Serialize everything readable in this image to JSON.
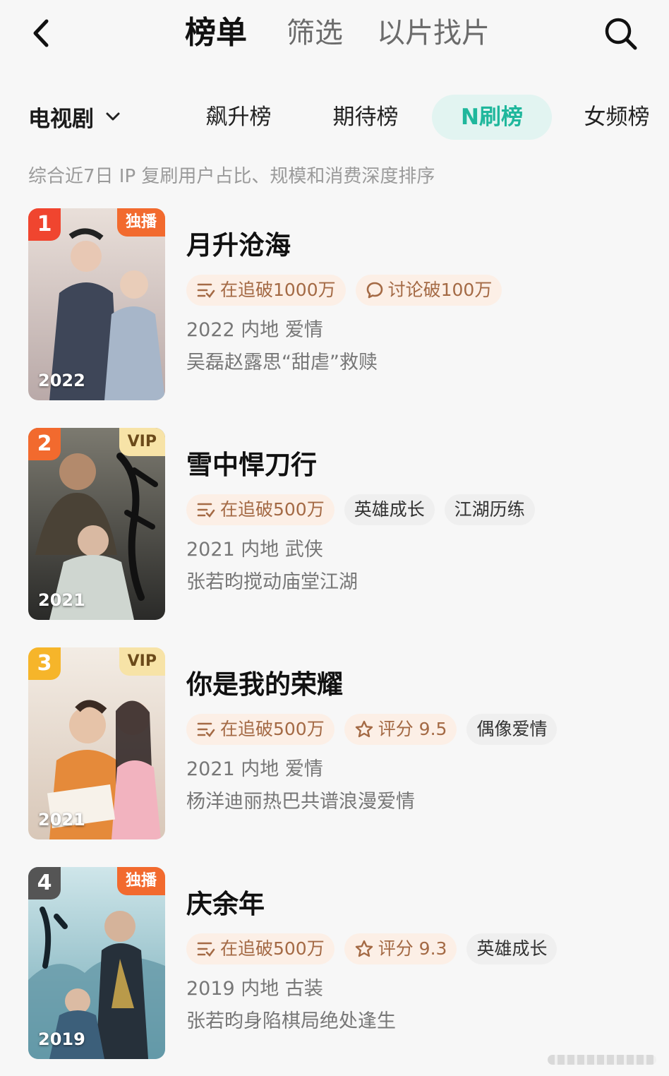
{
  "header": {
    "tabs": [
      {
        "label": "榜单",
        "active": true
      },
      {
        "label": "筛选",
        "active": false
      },
      {
        "label": "以片找片",
        "active": false
      }
    ],
    "back_icon": "chevron-left-icon",
    "search_icon": "search-icon"
  },
  "category": {
    "selected": "电视剧",
    "chevron_icon": "chevron-down-icon"
  },
  "rank_tabs": [
    {
      "label": "飙升榜",
      "active": false
    },
    {
      "label": "期待榜",
      "active": false
    },
    {
      "label": "N刷榜",
      "active": true
    },
    {
      "label": "女频榜",
      "active": false
    }
  ],
  "description": "综合近7日 IP 复刷用户占比、规模和消费深度排序",
  "colors": {
    "accent": "#1fb79c",
    "rank1": "#f0452f",
    "rank2": "#f26a2e",
    "rank3": "#f6b52a",
    "rank4": "#555555",
    "hot_tag_bg": "#fcefe6",
    "hot_tag_text": "#a46a45"
  },
  "items": [
    {
      "rank": "1",
      "badge": "独播",
      "badge_type": "exclusive",
      "poster_year": "2022",
      "title": "月升沧海",
      "tags": [
        {
          "icon": "list-icon",
          "text": "在追破1000万",
          "style": "hot"
        },
        {
          "icon": "comment-icon",
          "text": "讨论破100万",
          "style": "hot"
        }
      ],
      "meta": "2022 内地 爱情",
      "pitch": "吴磊赵露思“甜虐”救赎"
    },
    {
      "rank": "2",
      "badge": "VIP",
      "badge_type": "vip",
      "poster_year": "2021",
      "title": "雪中悍刀行",
      "tags": [
        {
          "icon": "list-icon",
          "text": "在追破500万",
          "style": "hot"
        },
        {
          "icon": "",
          "text": "英雄成长",
          "style": "plain"
        },
        {
          "icon": "",
          "text": "江湖历练",
          "style": "plain"
        }
      ],
      "meta": "2021 内地 武侠",
      "pitch": "张若昀搅动庙堂江湖"
    },
    {
      "rank": "3",
      "badge": "VIP",
      "badge_type": "vip",
      "poster_year": "2021",
      "title": "你是我的荣耀",
      "tags": [
        {
          "icon": "list-icon",
          "text": "在追破500万",
          "style": "hot"
        },
        {
          "icon": "star-icon",
          "text": "评分 9.5",
          "style": "hot"
        },
        {
          "icon": "",
          "text": "偶像爱情",
          "style": "plain"
        }
      ],
      "meta": "2021 内地 爱情",
      "pitch": "杨洋迪丽热巴共谱浪漫爱情"
    },
    {
      "rank": "4",
      "badge": "独播",
      "badge_type": "exclusive",
      "poster_year": "2019",
      "title": "庆余年",
      "tags": [
        {
          "icon": "list-icon",
          "text": "在追破500万",
          "style": "hot"
        },
        {
          "icon": "star-icon",
          "text": "评分 9.3",
          "style": "hot"
        },
        {
          "icon": "",
          "text": "英雄成长",
          "style": "plain"
        }
      ],
      "meta": "2019 内地 古装",
      "pitch": "张若昀身陷棋局绝处逢生"
    }
  ]
}
